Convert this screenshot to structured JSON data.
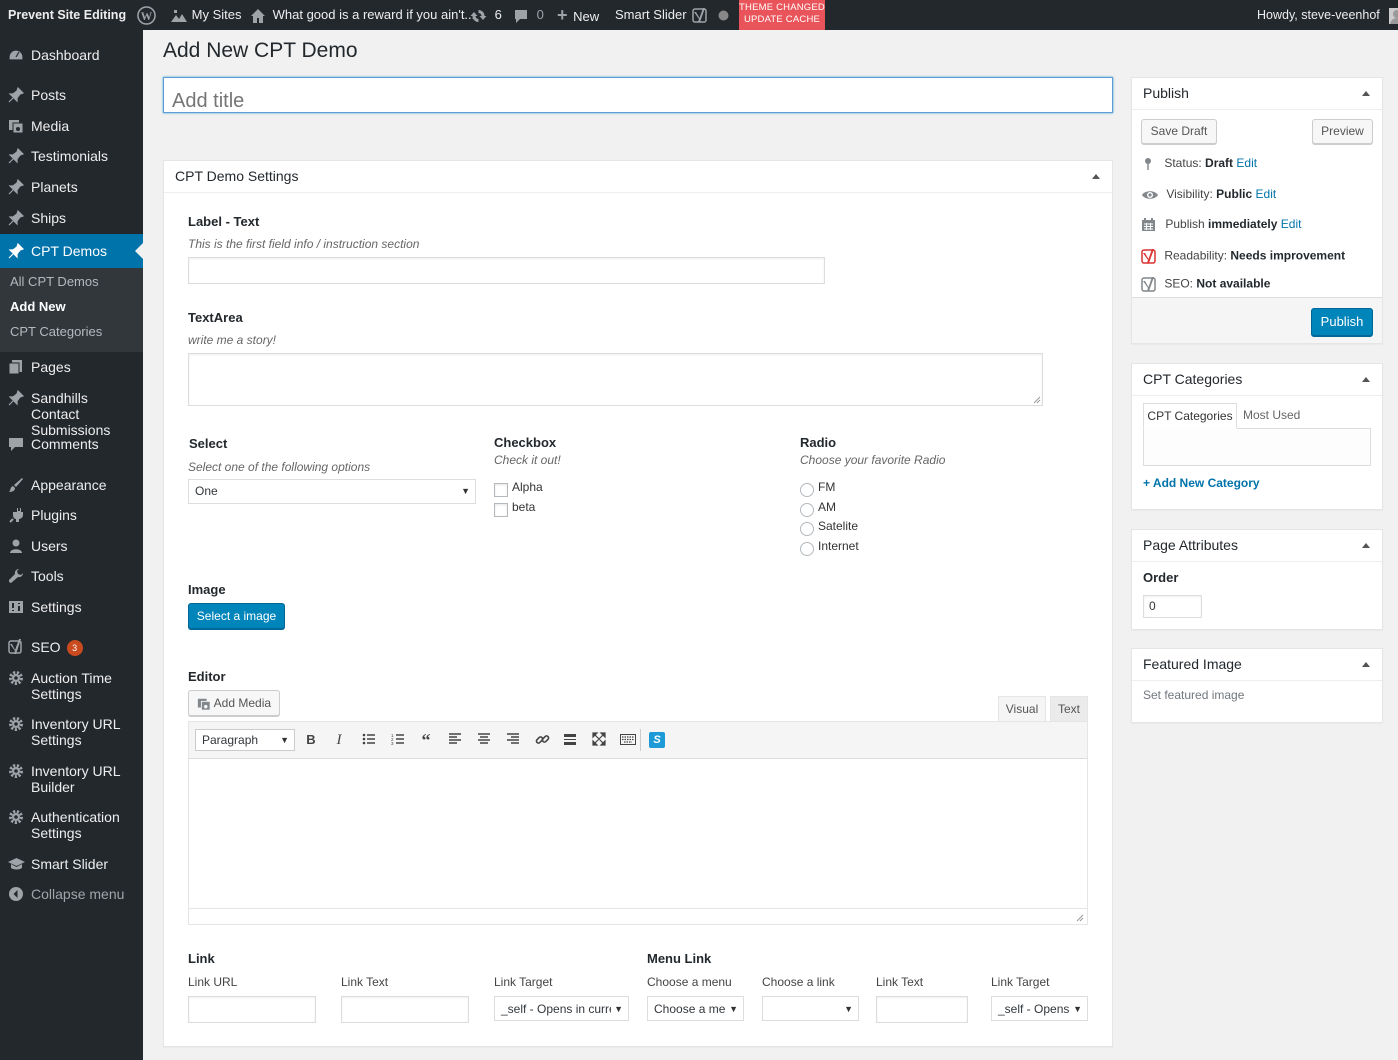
{
  "adminbar": {
    "site_name": "Prevent Site Editing",
    "my_sites": "My Sites",
    "site_title": "What good is a reward if you ain't...",
    "updates": "6",
    "comments": "0",
    "new": "New",
    "smart_slider": "Smart Slider",
    "cache_line1": "THEME CHANGED",
    "cache_line2": "UPDATE CACHE",
    "howdy": "Howdy, steve-veenhof"
  },
  "menu": {
    "dashboard": "Dashboard",
    "posts": "Posts",
    "media": "Media",
    "testimonials": "Testimonials",
    "planets": "Planets",
    "ships": "Ships",
    "cpt_demos": "CPT Demos",
    "sub_all": "All CPT Demos",
    "sub_add": "Add New",
    "sub_categories": "CPT Categories",
    "pages": "Pages",
    "sandhills": "Sandhills Contact Submissions",
    "comments": "Comments",
    "appearance": "Appearance",
    "plugins": "Plugins",
    "users": "Users",
    "tools": "Tools",
    "settings": "Settings",
    "seo": "SEO",
    "seo_badge": "3",
    "auction": "Auction Time Settings",
    "inv_settings": "Inventory URL Settings",
    "inv_builder": "Inventory URL Builder",
    "auth": "Authentication Settings",
    "smart_slider": "Smart Slider",
    "collapse": "Collapse menu"
  },
  "page": {
    "heading": "Add New CPT Demo",
    "title_placeholder": "Add title"
  },
  "settings_box": {
    "title": "CPT Demo Settings",
    "label_text": "Label - Text",
    "label_text_desc": "This is the first field info / instruction section",
    "textarea": "TextArea",
    "textarea_desc": "write me a story!",
    "select": "Select",
    "select_desc": "Select one of the following options",
    "select_value": "One",
    "checkbox": "Checkbox",
    "checkbox_desc": "Check it out!",
    "checkbox_options": [
      "Alpha",
      "beta"
    ],
    "radio": "Radio",
    "radio_desc": "Choose your favorite Radio",
    "radio_options": [
      "FM",
      "AM",
      "Satelite",
      "Internet"
    ],
    "image": "Image",
    "image_button": "Select a image",
    "editor": "Editor",
    "add_media": "Add Media",
    "tab_visual": "Visual",
    "tab_text": "Text",
    "format_value": "Paragraph",
    "link": "Link",
    "link_url": "Link URL",
    "link_text": "Link Text",
    "link_target": "Link Target",
    "link_target_value": "_self - Opens in curre",
    "menu_link": "Menu Link",
    "choose_menu": "Choose a menu",
    "choose_menu_value": "Choose a meı",
    "choose_link": "Choose a link",
    "choose_link_value": "",
    "menu_link_text": "Link Text",
    "menu_link_target": "Link Target",
    "menu_link_target_value": "_self - Opens"
  },
  "publish": {
    "title": "Publish",
    "save_draft": "Save Draft",
    "preview": "Preview",
    "status_label": "Status:",
    "status_value": "Draft",
    "visibility_label": "Visibility:",
    "visibility_value": "Public",
    "publish_label": "Publish",
    "publish_value": "immediately",
    "readability_label": "Readability:",
    "readability_value": "Needs improvement",
    "seo_label": "SEO:",
    "seo_value": "Not available",
    "edit": "Edit",
    "publish_button": "Publish"
  },
  "categories": {
    "title": "CPT Categories",
    "tab_all": "CPT Categories",
    "tab_most": "Most Used",
    "add_new": "+ Add New Category"
  },
  "attributes": {
    "title": "Page Attributes",
    "order_label": "Order",
    "order_value": "0"
  },
  "featured": {
    "title": "Featured Image",
    "set": "Set featured image"
  },
  "colors": {
    "accent": "#0073aa",
    "adminbar": "#23282d",
    "cache_badge": "#e9545a",
    "seo_badge": "#ca4a1f"
  }
}
